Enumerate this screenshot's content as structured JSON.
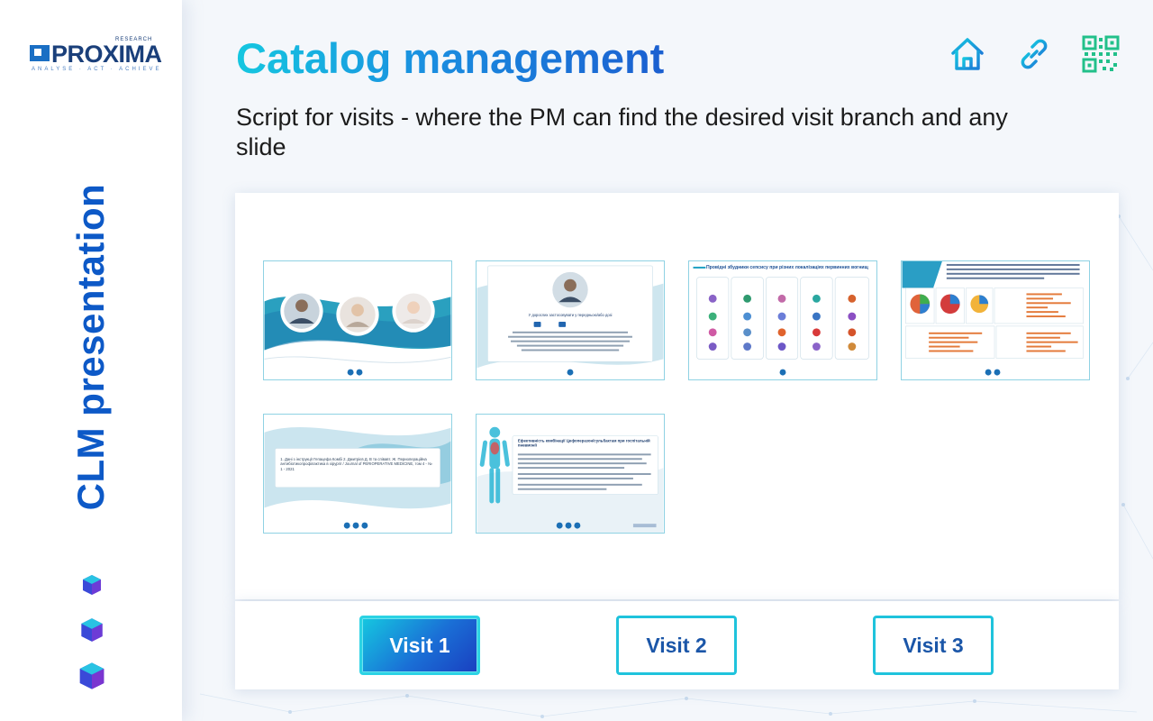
{
  "brand": {
    "logo_word": "PROXIMA",
    "logo_research": "RESEARCH",
    "logo_tagline": "ANALYSE · ACT · ACHIEVE",
    "side_title": "CLM presentation"
  },
  "header": {
    "title": "Catalog management",
    "subtitle": "Script for visits - where the PM can find the desired visit branch and any slide"
  },
  "header_icons": [
    "home-icon",
    "link-icon",
    "qr-code-icon"
  ],
  "slides": [
    {
      "name": "slide-children-portraits"
    },
    {
      "name": "slide-dosage-popup",
      "text": "У дорослих застосовувати у передньою/або дозі"
    },
    {
      "name": "slide-sepsis-sources",
      "title": "Провідні збудники сепсису при різних локалізаціях первинних вогнищ"
    },
    {
      "name": "slide-charts-report",
      "title": "З грудня 2008 р. по травень 2009 р. на базі медичної лабораторії інституту"
    },
    {
      "name": "slide-references-popup",
      "text": "1. Дані з інструкції Гепацефа Комбі 2. Дмитрієв Д. В та співавт. Ж. Периопераційна антибіотикопрофілактика в хірургії / Journal of PERIOPERATIVE MEDICINE, том 4 - № 1 - 2021"
    },
    {
      "name": "slide-body-efficacy",
      "title": "Ефективність комбінації Цефоперазон/сульбактам при госпітальній пневмонії"
    }
  ],
  "visits": [
    {
      "label": "Visit 1",
      "active": true
    },
    {
      "label": "Visit 2",
      "active": false
    },
    {
      "label": "Visit 3",
      "active": false
    }
  ],
  "colors": {
    "accent_cyan": "#15c7e0",
    "accent_blue": "#1b5fd0",
    "side_title": "#0d59c7",
    "qr_green": "#22c08a"
  }
}
